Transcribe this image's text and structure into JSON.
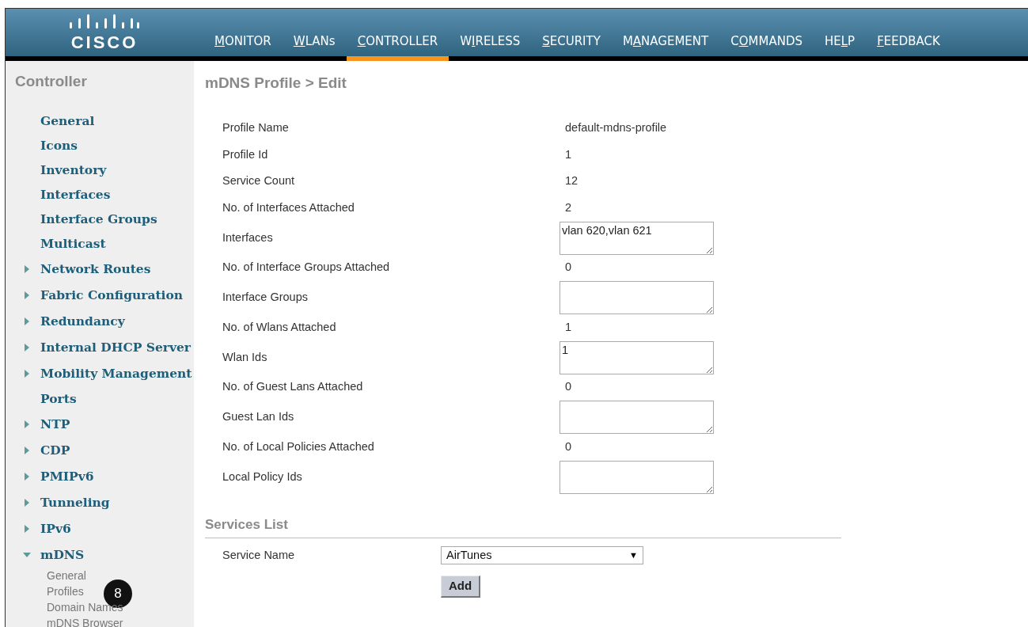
{
  "header": {
    "logo": "CISCO",
    "nav": [
      {
        "key": "M",
        "post": "ONITOR",
        "selected": false
      },
      {
        "key": "W",
        "post": "LANs",
        "selected": false
      },
      {
        "key": "C",
        "post": "ONTROLLER",
        "selected": true
      },
      {
        "pre": "W",
        "key": "I",
        "post": "RELESS",
        "selected": false
      },
      {
        "key": "S",
        "post": "ECURITY",
        "selected": false
      },
      {
        "pre": "M",
        "key": "A",
        "post": "NAGEMENT",
        "selected": false
      },
      {
        "pre": "C",
        "key": "O",
        "post": "MMANDS",
        "selected": false
      },
      {
        "pre": "HE",
        "key": "L",
        "post": "P",
        "selected": false
      },
      {
        "key": "F",
        "post": "EEDBACK",
        "selected": false
      }
    ]
  },
  "sidebar": {
    "title": "Controller",
    "items": [
      {
        "label": "General",
        "kind": "link"
      },
      {
        "label": "Icons",
        "kind": "link"
      },
      {
        "label": "Inventory",
        "kind": "link"
      },
      {
        "label": "Interfaces",
        "kind": "link"
      },
      {
        "label": "Interface Groups",
        "kind": "link"
      },
      {
        "label": "Multicast",
        "kind": "link"
      },
      {
        "label": "Network Routes",
        "kind": "group",
        "expanded": false
      },
      {
        "label": "Fabric Configuration",
        "kind": "group",
        "expanded": false
      },
      {
        "label": "Redundancy",
        "kind": "group",
        "expanded": false
      },
      {
        "label": "Internal DHCP Server",
        "kind": "group",
        "expanded": false
      },
      {
        "label": "Mobility Management",
        "kind": "group",
        "expanded": false
      },
      {
        "label": "Ports",
        "kind": "link"
      },
      {
        "label": "NTP",
        "kind": "group",
        "expanded": false
      },
      {
        "label": "CDP",
        "kind": "group",
        "expanded": false
      },
      {
        "label": "PMIPv6",
        "kind": "group",
        "expanded": false
      },
      {
        "label": "Tunneling",
        "kind": "group",
        "expanded": false
      },
      {
        "label": "IPv6",
        "kind": "group",
        "expanded": false
      },
      {
        "label": "mDNS",
        "kind": "group",
        "expanded": true,
        "children": [
          {
            "label": "General"
          },
          {
            "label": "Profiles",
            "callout": "8"
          },
          {
            "label": "Domain Names"
          },
          {
            "label": "mDNS Browser"
          }
        ]
      }
    ]
  },
  "page": {
    "title": "mDNS Profile > Edit",
    "fields": [
      {
        "label": "Profile Name",
        "kind": "text",
        "value": "default-mdns-profile"
      },
      {
        "label": "Profile Id",
        "kind": "text",
        "value": "1"
      },
      {
        "label": "Service Count",
        "kind": "text",
        "value": "12"
      },
      {
        "label": "No. of Interfaces Attached",
        "kind": "text",
        "value": "2"
      },
      {
        "label": "Interfaces",
        "kind": "textarea",
        "value": "vlan 620,vlan 621"
      },
      {
        "label": "No. of Interface Groups Attached",
        "kind": "text",
        "value": "0"
      },
      {
        "label": "Interface Groups",
        "kind": "textarea"
      },
      {
        "label": "No. of Wlans Attached",
        "kind": "text",
        "value": "1"
      },
      {
        "label": "Wlan Ids",
        "kind": "textarea",
        "value": "1"
      },
      {
        "label": "No. of Guest Lans Attached",
        "kind": "text",
        "value": "0"
      },
      {
        "label": "Guest Lan Ids",
        "kind": "textarea"
      },
      {
        "label": "No. of Local Policies Attached",
        "kind": "text",
        "value": "0"
      },
      {
        "label": "Local Policy Ids",
        "kind": "textarea"
      }
    ],
    "services": {
      "title": "Services List",
      "label": "Service Name",
      "value": "AirTunes",
      "arrow": "▼",
      "button": "Add"
    }
  }
}
